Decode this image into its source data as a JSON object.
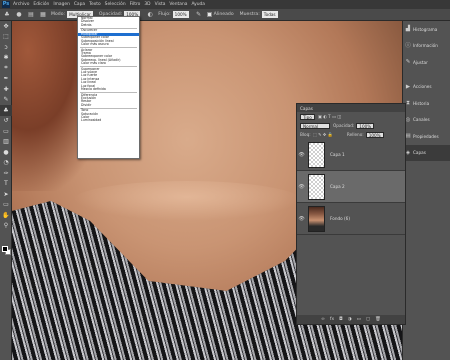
{
  "app": {
    "logo": "Ps"
  },
  "menu": [
    "Archivo",
    "Edición",
    "Imagen",
    "Capa",
    "Texto",
    "Selección",
    "Filtro",
    "3D",
    "Vista",
    "Ventana",
    "Ayuda"
  ],
  "options": {
    "mode_label": "Modo:",
    "mode_value": "Multiplicar",
    "opacity_label": "Opacidad:",
    "opacity_value": "100%",
    "flow_label": "Flujo:",
    "flow_value": "100%",
    "aligned_label": "Alineado",
    "sample_label": "Muestra:",
    "sample_value": "Todas"
  },
  "blend_options": [
    [
      "Normal",
      "Disolver",
      "Detrás"
    ],
    [
      "Oscurecer",
      "Multiplicar",
      "Subexponer color",
      "Subexposición lineal",
      "Color más oscuro"
    ],
    [
      "Aclarar",
      "Trama",
      "Sobreexponer color",
      "Sobreexp. lineal (Añadir)",
      "Color más claro"
    ],
    [
      "Superponer",
      "Luz suave",
      "Luz fuerte",
      "Luz intensa",
      "Luz lineal",
      "Luz focal",
      "Mezcla definida"
    ],
    [
      "Diferencia",
      "Exclusión",
      "Restar",
      "Dividir"
    ],
    [
      "Tono",
      "Saturación",
      "Color",
      "Luminosidad"
    ]
  ],
  "blend_selected": "Multiplicar",
  "dock": {
    "group1": [
      "Histograma",
      "Información",
      "Ajustar"
    ],
    "group2": [
      "Acciones",
      "Historia",
      "Canales",
      "Propiedades",
      "Capas"
    ],
    "active": "Capas"
  },
  "layers_panel": {
    "title": "Capas",
    "kind": "Tipo",
    "blend": "Normal",
    "opacity_label": "Opacidad:",
    "opacity_value": "100%",
    "lock_label": "Bloq:",
    "fill_label": "Relleno:",
    "fill_value": "100%",
    "layers": [
      {
        "name": "Capa 1",
        "type": "transparent",
        "selected": false
      },
      {
        "name": "Capa 2",
        "type": "transparent",
        "selected": true
      },
      {
        "name": "Fondo (6)",
        "type": "photo",
        "selected": false
      }
    ]
  },
  "colors": {
    "accent": "#1e6fd0",
    "panel": "#535353",
    "bar": "#383838"
  }
}
